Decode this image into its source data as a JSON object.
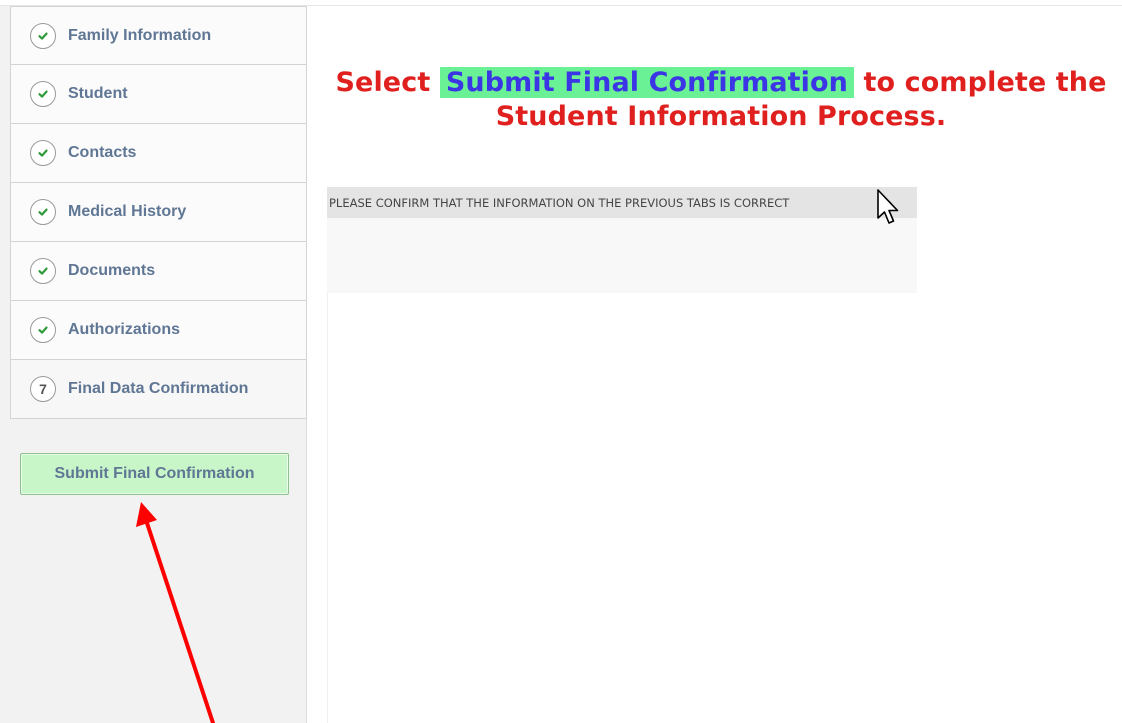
{
  "sidebar": {
    "steps": [
      {
        "label": "Family Information",
        "status": "complete",
        "icon": "check-icon"
      },
      {
        "label": "Student",
        "status": "complete",
        "icon": "check-icon"
      },
      {
        "label": "Contacts",
        "status": "complete",
        "icon": "check-icon"
      },
      {
        "label": "Medical History",
        "status": "complete",
        "icon": "check-icon"
      },
      {
        "label": "Documents",
        "status": "complete",
        "icon": "check-icon"
      },
      {
        "label": "Authorizations",
        "status": "complete",
        "icon": "check-icon"
      },
      {
        "label": "Final Data Confirmation",
        "status": "current",
        "number": "7"
      }
    ],
    "submit_label": "Submit Final Confirmation"
  },
  "headline": {
    "prefix": "Select ",
    "highlight": "Submit Final Confirmation",
    "suffix": " to complete the",
    "line2": "Student Information Process."
  },
  "panel": {
    "header": "PLEASE CONFIRM THAT THE INFORMATION ON THE PREVIOUS TABS IS CORRECT"
  },
  "colors": {
    "headline_red": "#e0201e",
    "highlight_green": "#6bf195",
    "highlight_text_blue": "#3b35e6",
    "check_green": "#2e9a3a",
    "button_green": "#c8f6c8",
    "annotation_arrow": "#ff0000"
  }
}
